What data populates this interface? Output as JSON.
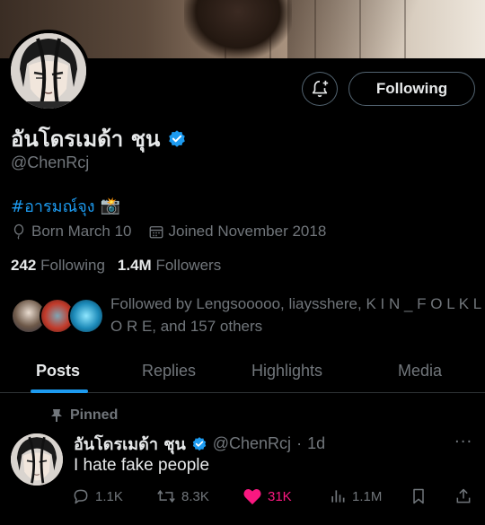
{
  "profile": {
    "display_name": "อันโดรเมด้า ชุน",
    "handle": "@ChenRcj",
    "bio_hashtag": "#อารมณ์จุง",
    "bio_emoji": "📸",
    "born": "Born March 10",
    "joined": "Joined November 2018",
    "following_count": "242",
    "following_label": "Following",
    "followers_count": "1.4M",
    "followers_label": "Followers",
    "followed_by": "Followed by Lengsooooo, liaysshere, K I N _ F O L K L O R E, and 157 others"
  },
  "header": {
    "follow_button": "Following",
    "notify_icon": "bell-plus-icon"
  },
  "tabs": [
    {
      "label": "Posts",
      "active": true
    },
    {
      "label": "Replies",
      "active": false
    },
    {
      "label": "Highlights",
      "active": false
    },
    {
      "label": "Media",
      "active": false
    }
  ],
  "pinned_post": {
    "pinned_label": "Pinned",
    "author": "อันโดรเมด้า ชุน",
    "handle": "@ChenRcj",
    "separator": "·",
    "time": "1d",
    "text": "I hate fake people",
    "replies": "1.1K",
    "reposts": "8.3K",
    "likes": "31K",
    "views": "1.1M"
  },
  "colors": {
    "accent": "#1d9bf0",
    "like": "#f91880",
    "muted": "#71767b",
    "text": "#e7e9ea",
    "background": "#000000"
  }
}
